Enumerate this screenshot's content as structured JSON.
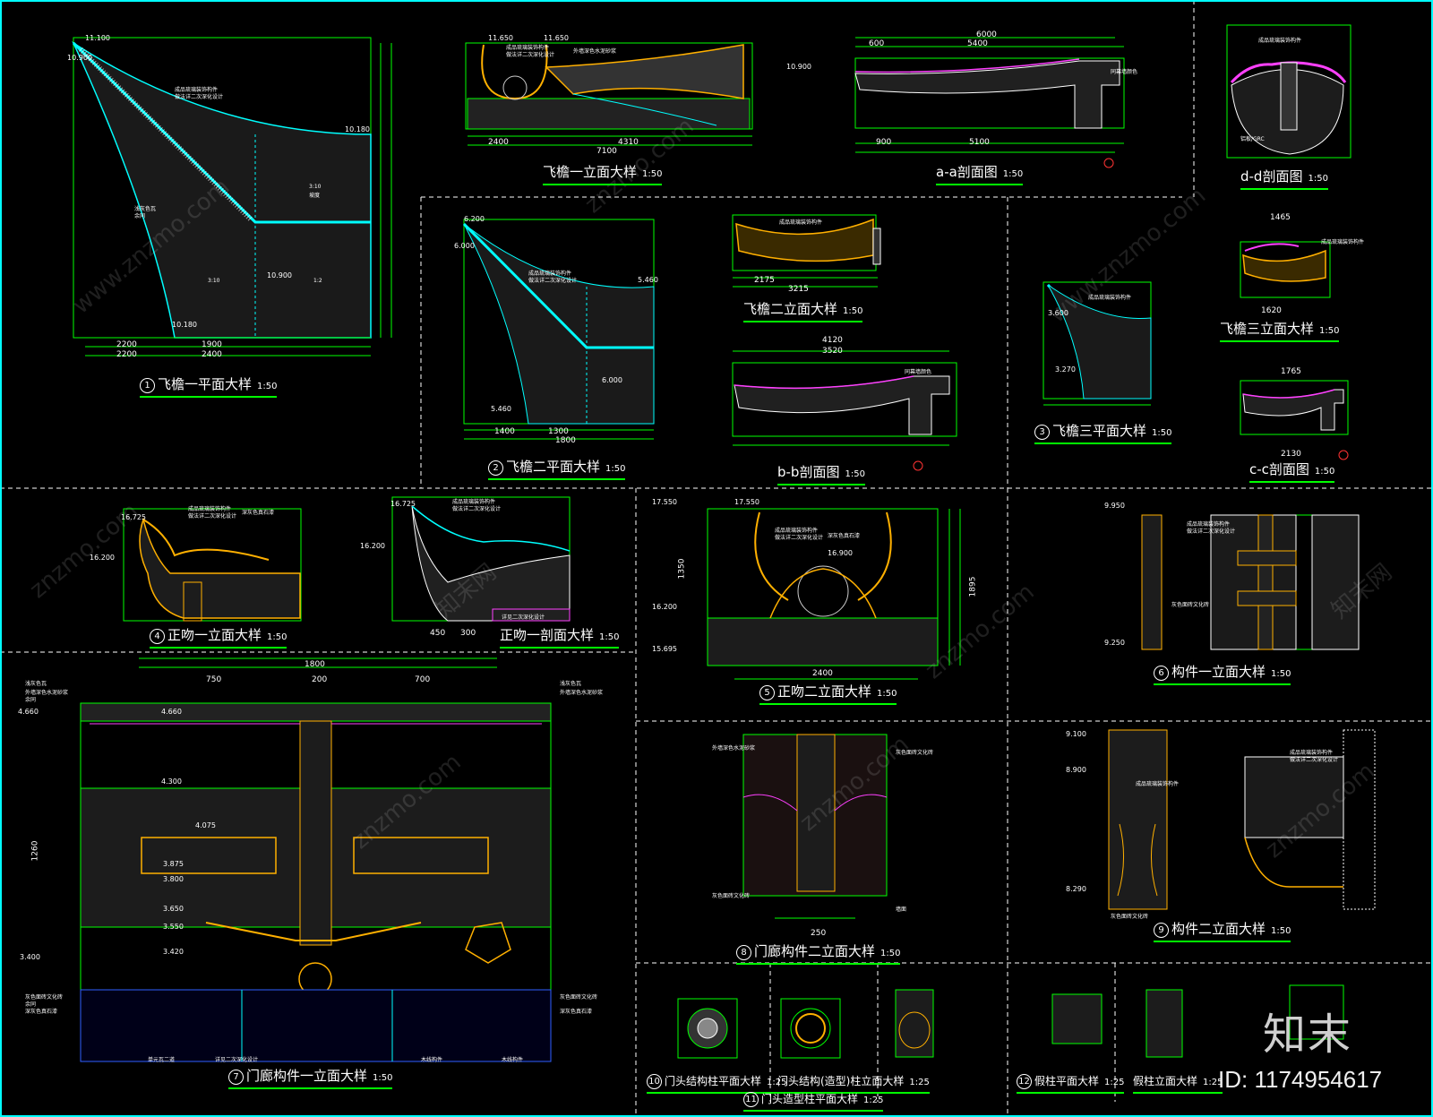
{
  "titles": [
    {
      "key": "t1",
      "num": "1",
      "text": "飞檐一平面大样",
      "scale": "1:50"
    },
    {
      "key": "t2",
      "num": "",
      "text": "飞檐一立面大样",
      "scale": "1:50"
    },
    {
      "key": "t3",
      "num": "",
      "text": "a-a剖面图",
      "scale": "1:50"
    },
    {
      "key": "t4",
      "num": "",
      "text": "d-d剖面图",
      "scale": "1:50"
    },
    {
      "key": "t5",
      "num": "2",
      "text": "飞檐二平面大样",
      "scale": "1:50"
    },
    {
      "key": "t6",
      "num": "",
      "text": "飞檐二立面大样",
      "scale": "1:50"
    },
    {
      "key": "t7",
      "num": "",
      "text": "b-b剖面图",
      "scale": "1:50"
    },
    {
      "key": "t8",
      "num": "3",
      "text": "飞檐三平面大样",
      "scale": "1:50"
    },
    {
      "key": "t9",
      "num": "",
      "text": "飞檐三立面大样",
      "scale": "1:50"
    },
    {
      "key": "t10",
      "num": "",
      "text": "c-c剖面图",
      "scale": "1:50"
    },
    {
      "key": "t11",
      "num": "4",
      "text": "正吻一立面大样",
      "scale": "1:50"
    },
    {
      "key": "t12",
      "num": "",
      "text": "正吻一剖面大样",
      "scale": "1:50"
    },
    {
      "key": "t13",
      "num": "5",
      "text": "正吻二立面大样",
      "scale": "1:50"
    },
    {
      "key": "t14",
      "num": "6",
      "text": "构件一立面大样",
      "scale": "1:50"
    },
    {
      "key": "t15",
      "num": "7",
      "text": "门廊构件一立面大样",
      "scale": "1:50"
    },
    {
      "key": "t16",
      "num": "8",
      "text": "门廊构件二立面大样",
      "scale": "1:50"
    },
    {
      "key": "t17",
      "num": "9",
      "text": "构件二立面大样",
      "scale": "1:50"
    },
    {
      "key": "t18",
      "num": "10",
      "text": "门头结构柱平面大样",
      "scale": "1:25"
    },
    {
      "key": "t19",
      "num": "",
      "text": "门头结构(造型)柱立面大样",
      "scale": "1:25"
    },
    {
      "key": "t20",
      "num": "11",
      "text": "门头造型柱平面大样",
      "scale": "1:25"
    },
    {
      "key": "t21",
      "num": "12",
      "text": "假柱平面大样",
      "scale": "1:25"
    },
    {
      "key": "t22",
      "num": "",
      "text": "假柱立面大样",
      "scale": "1:25"
    }
  ],
  "dimensions": {
    "d1": "2200",
    "d2": "1900",
    "d3": "2400",
    "d4": "2200",
    "d5": "2400",
    "d6": "7100",
    "d7": "4310",
    "d8": "6000",
    "d9": "5400",
    "d10": "600",
    "d11": "5100",
    "d12": "900",
    "d13": "1400",
    "d14": "1300",
    "d15": "1800",
    "d16": "2175",
    "d17": "3215",
    "d18": "4120",
    "d19": "3520",
    "d20": "1465",
    "d21": "1620",
    "d22": "2130",
    "d23": "1765",
    "d24": "450",
    "d25": "300",
    "d26": "2400",
    "d27": "1800",
    "d28": "750",
    "d29": "700",
    "d30": "200",
    "d31": "250",
    "d32": "1350",
    "d33": "1895",
    "d34": "1260"
  },
  "levels": {
    "l1": "11.100",
    "l2": "10.900",
    "l3": "10.180",
    "l4": "10.900",
    "l5": "10.180",
    "l6": "11.650",
    "l7": "11.650",
    "l8": "10.900",
    "l9": "6.200",
    "l10": "6.000",
    "l11": "5.460",
    "l12": "6.000",
    "l13": "5.460",
    "l14": "3.600",
    "l15": "3.270",
    "l16": "16.725",
    "l17": "16.200",
    "l18": "16.725",
    "l19": "16.200",
    "l20": "17.550",
    "l21": "17.550",
    "l22": "16.900",
    "l23": "16.200",
    "l24": "15.695",
    "l25": "9.950",
    "l26": "9.250",
    "l27": "4.660",
    "l28": "4.660",
    "l29": "4.300",
    "l30": "4.075",
    "l31": "3.875",
    "l32": "3.800",
    "l33": "3.650",
    "l34": "3.550",
    "l35": "3.420",
    "l36": "3.400",
    "l37": "8.900",
    "l38": "8.290",
    "l39": "9.100"
  },
  "notes": {
    "n1": "成品琉璃装饰构件",
    "n2": "做法详二次深化设计",
    "n3": "浅灰色瓦",
    "n4": "深灰色真石漆",
    "n5": "外墙深色水泥砂浆",
    "n6": "灰色面砖文化砖",
    "n7": "余同",
    "n8": "同幕墙颜色",
    "n9": "木线构件",
    "n10": "单元瓦二道",
    "n11": "铝板/GRC",
    "n12": "墙面",
    "n13": "3:10",
    "n14": "1:2",
    "n15": "坡度",
    "n16": "详见二次深化设计"
  },
  "watermarks": [
    "znzmo.com",
    "www.znzmo.com",
    "知末网"
  ],
  "branding": {
    "logo": "知末",
    "id_label": "ID: 1174954617"
  },
  "colors": {
    "line": "#00ff00",
    "gold": "#ffb000",
    "cyan": "#00e0ff",
    "magenta": "#ff40ff",
    "white": "#ffffff",
    "grey": "#bfbfbf",
    "red": "#ff3333",
    "blue": "#3060ff"
  }
}
